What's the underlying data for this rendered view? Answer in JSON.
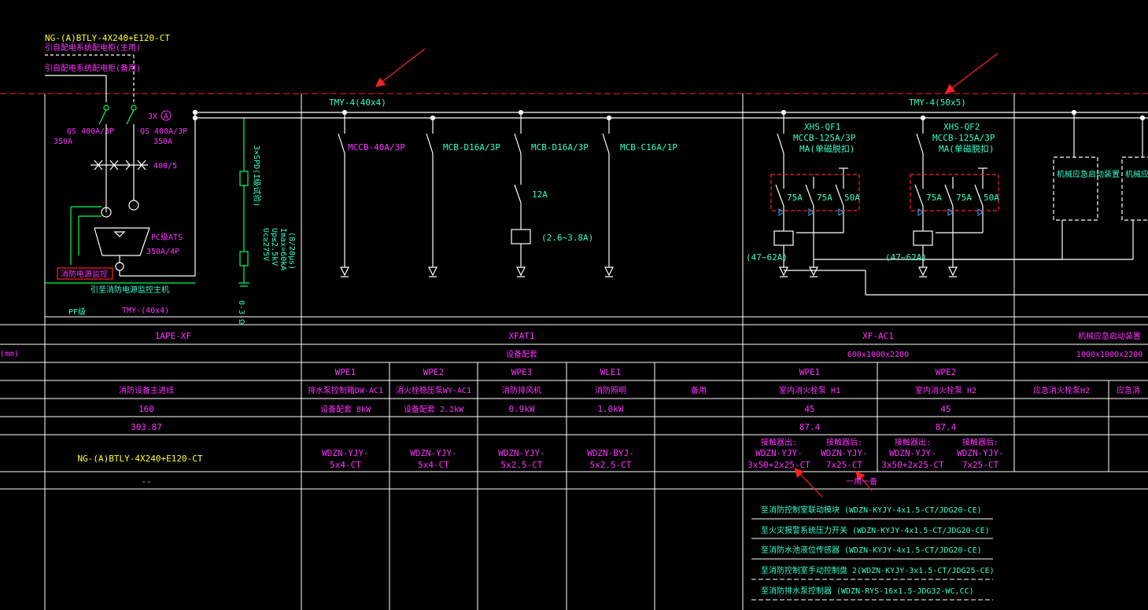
{
  "drawing": {
    "incoming": {
      "cable_top": "NG-(A)BTLY-4X240+E120-CT",
      "cable_main_note": "引自配电系统配电柜(主用)",
      "cable_backup_note": "引自配电系统配电柜(备用)",
      "qs_left": "QS 400A/3P",
      "qs_left_rating": "350A",
      "qs_right": "QS 400A/3P",
      "qs_right_rating": "350A",
      "ct_count": "3X",
      "ct_symbol": "A",
      "ct_ratio": "400/5",
      "ats_label": "PC级ATS",
      "ats_rating": "350A/4P",
      "fire_box": "消防电源监控",
      "fire_note": "引至消防电源监控主机",
      "pf_note": "PF级",
      "bus_left": "TMY-(40x4)",
      "spd_label_1": "3×SPD(I级试验)",
      "spd_label_2": "Uc≥275V",
      "spd_label_3": "Up≤2.5kV",
      "spd_label_4": "Imax=60kA",
      "spd_label_5": "(8/20μs)",
      "spd_ground": "0-3-Ω"
    },
    "bus_mid": "TMY-4(40x4)",
    "bus_right": "TMY-4(50x5)",
    "breakers_mid": [
      {
        "label": "MCCB-40A/3P"
      },
      {
        "label": "MCB-D16A/3P"
      },
      {
        "label": "MCB-D16A/3P",
        "sub": "12A",
        "relay": "(2.6~3.8A)"
      },
      {
        "label": "MCB-C16A/1P"
      }
    ],
    "breakers_right": [
      {
        "name": "XHS-QF1",
        "type": "MCCB-125A/3P",
        "note": "MA(单磁脱扣)",
        "c1": "75A",
        "c2": "75A",
        "c3": "50A",
        "relay": "(47~62A)"
      },
      {
        "name": "XHS-QF2",
        "type": "MCCB-125A/3P",
        "note": "MA(单磁脱扣)",
        "c1": "75A",
        "c2": "75A",
        "c3": "50A",
        "relay": "(47~62A)"
      }
    ],
    "far_boxes": [
      "机械应急启动装置",
      "机械应急启动装置"
    ]
  },
  "table": {
    "left_unit": "(mm)",
    "panels": {
      "p1": "1APE-XF",
      "p2": "XFAT1",
      "p3": "XF-AC1",
      "p4": "机械应急启动装置"
    },
    "sizes": {
      "p2": "设备配套",
      "p3": "600x1000x2200",
      "p4": "1000x1000x2200"
    },
    "circuits": [
      "WPE1",
      "WPE2",
      "WPE3",
      "WLE1",
      "WPE1",
      "WPE2"
    ],
    "names": [
      "消防设备主进线",
      "排水泵控制箱DW-AC1",
      "消火栓稳压泵WY-AC1",
      "消防排风机",
      "消防照明",
      "备用",
      "室内消火栓泵 H1",
      "室内消火栓泵 H2",
      "应急消火栓泵H2",
      "应急消"
    ],
    "powers": [
      "160",
      "设备配套  8kW",
      "设备配套  2.2kW",
      "0.9kW",
      "1.0kW",
      "45",
      "45"
    ],
    "currents": [
      "303.87",
      "87.4",
      "87.4"
    ],
    "cables": [
      "NG-(A)BTLY-4X240+E120-CT",
      "WDZN-YJY-\n5x4-CT",
      "WDZN-YJY-\n5x4-CT",
      "WDZN-YJY-\n5x2.5-CT",
      "WDZN-BYJ-\n5x2.5-CT"
    ],
    "cables_right": [
      {
        "head": "接触器出:",
        "l1": "WDZN-YJY-",
        "l2": "3x50+2x25-CT"
      },
      {
        "head": "接触器后:",
        "l1": "WDZN-YJY-",
        "l2": "7x25-CT"
      },
      {
        "head": "接触器出:",
        "l1": "WDZN-YJY-",
        "l2": "3x50+2x25-CT"
      },
      {
        "head": "接触器后:",
        "l1": "WDZN-YJY-",
        "l2": "7x25-CT"
      }
    ],
    "dash": "--",
    "one_use": "一用一备",
    "notes": [
      "至消防控制室联动模块    (WDZN-KYJY-4x1.5-CT/JDG20-CE)",
      "至火灾报警系统压力开关 (WDZN-KYJY-4x1.5-CT/JDG20-CE)",
      "至消防水池液位传感器     (WDZN-KYJY-4x1.5-CT/JDG20-CE)",
      "至消防控制室手动控制盘  2(WDZN-KYJY-3x1.5-CT/JDG25-CE)",
      "至消防排水泵控制器   (WDZN-RYS-16x1.5-JDG32-WC,CC)"
    ]
  },
  "colors": {
    "bg": "#000000",
    "line": "#ffffff",
    "cyan": "#33ffcc",
    "magenta": "#ff33ff",
    "yellow": "#ffff33",
    "red": "#ff2222",
    "green": "#00ff55"
  }
}
